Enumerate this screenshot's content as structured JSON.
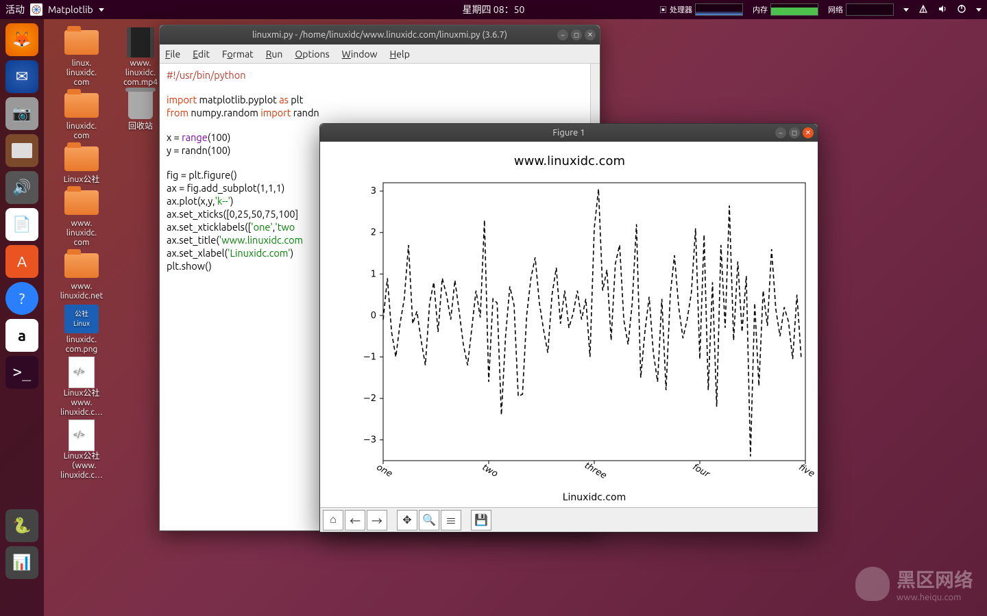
{
  "topbar": {
    "activities": "活动",
    "app_name": "Matplotlib",
    "datetime": "星期四 08：50",
    "cpu_label": "处理器",
    "mem_label": "内存",
    "net_label": "网络"
  },
  "launcher": {
    "items": [
      "firefox",
      "thunderbird",
      "camera",
      "files",
      "speaker",
      "writer",
      "software",
      "help",
      "amazon",
      "terminal"
    ]
  },
  "desktop": {
    "icons": [
      {
        "label": "linux.\nlinuxidc.\ncom",
        "type": "folder"
      },
      {
        "label": "www.\nlinuxidc.\ncom.mp4",
        "type": "film"
      },
      {
        "label": "linuxidc.\ncom",
        "type": "folder"
      },
      {
        "label": "回收站",
        "type": "trash"
      },
      {
        "label": "Linux公社",
        "type": "folder"
      },
      {
        "label": "www.\nlinuxidc.\ncom",
        "type": "folder"
      },
      {
        "label": "www.\nlinuxidc.net",
        "type": "folder"
      },
      {
        "label": "linuxidc.\ncom.png",
        "type": "pngimg"
      },
      {
        "label": "Linux公社\nwww.\nlinuxidc.c…",
        "type": "page"
      },
      {
        "label": "Linux公社\n（www.\nlinuxidc.c…",
        "type": "page"
      }
    ]
  },
  "idle": {
    "title": "linuxmi.py - /home/linuxidc/www.linuxidc.com/linuxmi.py (3.6.7)",
    "menus": [
      "File",
      "Edit",
      "Format",
      "Run",
      "Options",
      "Window",
      "Help"
    ],
    "code": {
      "shebang": "#!/usr/bin/python",
      "l1a": "import",
      "l1b": " matplotlib.pyplot ",
      "l1c": "as",
      "l1d": " plt",
      "l2a": "from",
      "l2b": " numpy.random ",
      "l2c": "import",
      "l2d": " randn",
      "l3": "x = ",
      "l3b": "range",
      "l3c": "(100)",
      "l4": "y = randn(100)",
      "l5": "fig = plt.figure()",
      "l6": "ax = fig.add_subplot(1,1,1)",
      "l7a": "ax.plot(x,y,",
      "l7b": "'k--'",
      "l7c": ")",
      "l8": "ax.set_xticks([0,25,50,75,100]",
      "l9a": "ax.set_xticklabels([",
      "l9b": "'one'",
      "l9c": ",",
      "l9d": "'two",
      "l10a": "ax.set_title(",
      "l10b": "'www.linuxidc.com",
      "l11a": "ax.set_xlabel(",
      "l11b": "'Linuxidc.com'",
      "l11c": ")",
      "l12": "plt.show()"
    }
  },
  "figure": {
    "title": "Figure 1",
    "toolbar": [
      "home",
      "back",
      "forward",
      "pan",
      "zoom",
      "config",
      "save"
    ]
  },
  "chart_data": {
    "type": "line",
    "title": "www.linuxidc.com",
    "xlabel": "Linuxidc.com",
    "ylabel": "",
    "xlim": [
      0,
      100
    ],
    "ylim": [
      -3.5,
      3.2
    ],
    "yticks": [
      -3,
      -2,
      -1,
      0,
      1,
      2,
      3
    ],
    "xticks": [
      0,
      25,
      50,
      75,
      100
    ],
    "xticklabels": [
      "one",
      "two",
      "three",
      "four",
      "five"
    ],
    "xtick_rotation": 30,
    "line_style": "k--",
    "x": [
      0,
      1,
      2,
      3,
      4,
      5,
      6,
      7,
      8,
      9,
      10,
      11,
      12,
      13,
      14,
      15,
      16,
      17,
      18,
      19,
      20,
      21,
      22,
      23,
      24,
      25,
      26,
      27,
      28,
      29,
      30,
      31,
      32,
      33,
      34,
      35,
      36,
      37,
      38,
      39,
      40,
      41,
      42,
      43,
      44,
      45,
      46,
      47,
      48,
      49,
      50,
      51,
      52,
      53,
      54,
      55,
      56,
      57,
      58,
      59,
      60,
      61,
      62,
      63,
      64,
      65,
      66,
      67,
      68,
      69,
      70,
      71,
      72,
      73,
      74,
      75,
      76,
      77,
      78,
      79,
      80,
      81,
      82,
      83,
      84,
      85,
      86,
      87,
      88,
      89,
      90,
      91,
      92,
      93,
      94,
      95,
      96,
      97,
      98,
      99
    ],
    "y": [
      -0.1,
      0.9,
      -0.4,
      -1.0,
      -0.2,
      0.4,
      1.7,
      -0.2,
      0.1,
      -0.6,
      -1.2,
      0.3,
      0.8,
      -0.4,
      0.9,
      0.5,
      -0.1,
      0.85,
      0.1,
      -0.7,
      -1.2,
      -0.3,
      0.6,
      -0.05,
      2.3,
      -1.6,
      0.4,
      0.3,
      -2.4,
      -0.5,
      0.7,
      0.25,
      -1.95,
      -1.9,
      0.0,
      0.9,
      1.4,
      0.3,
      -0.35,
      -0.9,
      0.5,
      1.15,
      -0.2,
      0.6,
      -0.3,
      0.05,
      0.6,
      -0.1,
      0.4,
      -1.0,
      2.1,
      3.05,
      0.6,
      1.1,
      -0.6,
      1.25,
      1.7,
      -0.1,
      -0.7,
      0.3,
      2.2,
      -1.5,
      -0.4,
      0.45,
      -0.9,
      -1.6,
      0.4,
      -1.8,
      0.5,
      1.45,
      0.2,
      -0.55,
      -0.1,
      0.55,
      2.1,
      -1.05,
      1.95,
      -1.8,
      0.8,
      -2.2,
      1.7,
      -0.3,
      2.65,
      -0.6,
      1.3,
      -0.4,
      0.95,
      -3.4,
      0.3,
      -1.7,
      0.6,
      -0.25,
      1.6,
      0.15,
      -0.5,
      0.2,
      -0.15,
      -1.05,
      0.5,
      -1.0
    ]
  },
  "watermark": {
    "text": "黑区网络",
    "sub": "www.heiqu.com"
  }
}
